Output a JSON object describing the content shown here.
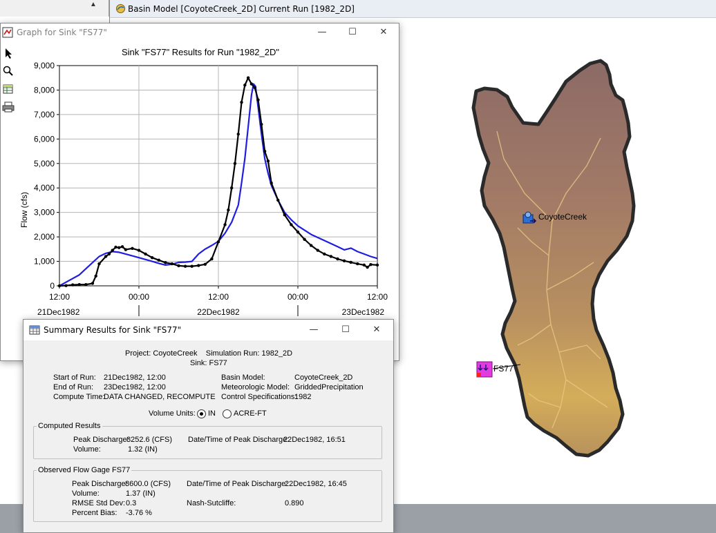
{
  "basin_window": {
    "title": "Basin Model [CoyoteCreek_2D] Current Run [1982_2D]",
    "elements": [
      {
        "name": "CoyoteCreek"
      },
      {
        "name": "FS77"
      }
    ]
  },
  "graph_window": {
    "title": "Graph for Sink \"FS77\"",
    "controls": {
      "minimize": "—",
      "maximize": "☐",
      "close": "✕"
    },
    "tools": [
      "pointer-icon",
      "zoom-icon",
      "table-icon",
      "print-icon"
    ]
  },
  "chart_data": {
    "type": "line",
    "title": "Sink \"FS77\" Results for Run \"1982_2D\"",
    "ylabel": "Flow (cfs)",
    "xlabel": "",
    "ylim": [
      0,
      9000
    ],
    "yticks": [
      "0",
      "1,000",
      "2,000",
      "3,000",
      "4,000",
      "5,000",
      "6,000",
      "7,000",
      "8,000",
      "9,000"
    ],
    "yticks_values": [
      0,
      1000,
      2000,
      3000,
      4000,
      5000,
      6000,
      7000,
      8000,
      9000
    ],
    "xlim": [
      0,
      48
    ],
    "xticks": [
      "12:00",
      "00:00",
      "12:00",
      "00:00",
      "12:00"
    ],
    "xticks_values": [
      0,
      12,
      24,
      36,
      48
    ],
    "date_labels": [
      "21Dec1982",
      "22Dec1982",
      "23Dec1982"
    ],
    "grid": true,
    "series": [
      {
        "color": "#1e1ee0",
        "marker": false,
        "points": [
          [
            0,
            0
          ],
          [
            1,
            150
          ],
          [
            3,
            450
          ],
          [
            5,
            950
          ],
          [
            6,
            1200
          ],
          [
            7,
            1330
          ],
          [
            8,
            1400
          ],
          [
            9,
            1370
          ],
          [
            10,
            1300
          ],
          [
            12,
            1150
          ],
          [
            14,
            1000
          ],
          [
            15,
            920
          ],
          [
            16,
            850
          ],
          [
            17,
            880
          ],
          [
            18,
            960
          ],
          [
            19,
            970
          ],
          [
            20,
            1000
          ],
          [
            21,
            1300
          ],
          [
            22,
            1500
          ],
          [
            23,
            1650
          ],
          [
            24,
            1820
          ],
          [
            25,
            2150
          ],
          [
            26,
            2600
          ],
          [
            27,
            3300
          ],
          [
            27.5,
            4200
          ],
          [
            28,
            5200
          ],
          [
            28.5,
            6500
          ],
          [
            29,
            7800
          ],
          [
            29.3,
            8250
          ],
          [
            29.6,
            8150
          ],
          [
            30,
            7300
          ],
          [
            30.5,
            6200
          ],
          [
            31,
            5200
          ],
          [
            31.5,
            4600
          ],
          [
            32,
            4100
          ],
          [
            33,
            3500
          ],
          [
            34,
            3000
          ],
          [
            35,
            2700
          ],
          [
            36,
            2450
          ],
          [
            38,
            2100
          ],
          [
            40,
            1850
          ],
          [
            42,
            1600
          ],
          [
            43,
            1470
          ],
          [
            44,
            1540
          ],
          [
            45,
            1400
          ],
          [
            46,
            1300
          ],
          [
            47,
            1200
          ],
          [
            48,
            1120
          ]
        ]
      },
      {
        "color": "#000000",
        "marker": true,
        "points": [
          [
            0,
            0
          ],
          [
            1,
            10
          ],
          [
            2,
            40
          ],
          [
            3,
            50
          ],
          [
            4,
            50
          ],
          [
            5,
            100
          ],
          [
            5.5,
            400
          ],
          [
            6,
            900
          ],
          [
            7,
            1200
          ],
          [
            7.5,
            1300
          ],
          [
            8,
            1450
          ],
          [
            8.5,
            1580
          ],
          [
            9,
            1560
          ],
          [
            9.5,
            1600
          ],
          [
            10,
            1480
          ],
          [
            11,
            1530
          ],
          [
            12,
            1450
          ],
          [
            13,
            1300
          ],
          [
            14,
            1150
          ],
          [
            15,
            1050
          ],
          [
            16,
            950
          ],
          [
            17,
            900
          ],
          [
            18,
            820
          ],
          [
            19,
            800
          ],
          [
            20,
            800
          ],
          [
            21,
            830
          ],
          [
            22,
            880
          ],
          [
            23,
            1100
          ],
          [
            24,
            1800
          ],
          [
            25,
            2500
          ],
          [
            25.5,
            3100
          ],
          [
            26,
            4000
          ],
          [
            26.5,
            5000
          ],
          [
            27,
            6200
          ],
          [
            27.5,
            7500
          ],
          [
            28,
            8200
          ],
          [
            28.5,
            8500
          ],
          [
            29,
            8250
          ],
          [
            29.5,
            8100
          ],
          [
            30,
            7600
          ],
          [
            30.5,
            6600
          ],
          [
            31,
            5500
          ],
          [
            31.5,
            5100
          ],
          [
            32,
            4200
          ],
          [
            33,
            3500
          ],
          [
            34,
            2900
          ],
          [
            35,
            2500
          ],
          [
            36,
            2200
          ],
          [
            37,
            1900
          ],
          [
            38,
            1650
          ],
          [
            39,
            1450
          ],
          [
            40,
            1300
          ],
          [
            41,
            1200
          ],
          [
            42,
            1100
          ],
          [
            43,
            1020
          ],
          [
            44,
            960
          ],
          [
            45,
            900
          ],
          [
            46,
            850
          ],
          [
            46.5,
            760
          ],
          [
            47,
            870
          ],
          [
            48,
            850
          ]
        ]
      }
    ]
  },
  "summary_window": {
    "title": "Summary Results for Sink \"FS77\"",
    "controls": {
      "minimize": "—",
      "maximize": "☐",
      "close": "✕"
    },
    "project_line": "Project: CoyoteCreek    Simulation Run: 1982_2D",
    "sink_line": "Sink: FS77",
    "info": {
      "start_label": "Start of Run:",
      "start_value": "21Dec1982, 12:00",
      "end_label": "End of Run:",
      "end_value": "23Dec1982, 12:00",
      "compute_label": "Compute Time:",
      "compute_value": "DATA CHANGED, RECOMPUTE",
      "basin_label": "Basin Model:",
      "basin_value": "CoyoteCreek_2D",
      "met_label": "Meteorologic Model:",
      "met_value": "GriddedPrecipitation",
      "control_label": "Control Specifications:",
      "control_value": "1982"
    },
    "volume_units": {
      "label": "Volume Units:",
      "options": [
        "IN",
        "ACRE-FT"
      ],
      "selected": "IN"
    },
    "computed": {
      "group_title": "Computed Results",
      "peak_label": "Peak Discharge:",
      "peak_value": "8252.6 (CFS)",
      "date_label": "Date/Time of Peak Discharge:",
      "date_value": "22Dec1982, 16:51",
      "volume_label": "Volume:",
      "volume_value": "1.32 (IN)"
    },
    "observed": {
      "group_title": "Observed Flow Gage FS77",
      "peak_label": "Peak Discharge:",
      "peak_value": "8600.0 (CFS)",
      "date_label": "Date/Time of Peak Discharge:",
      "date_value": "22Dec1982, 16:45",
      "volume_label": "Volume:",
      "volume_value": "1.37 (IN)",
      "rmse_label": "RMSE Std Dev:",
      "rmse_value": "0.3",
      "nash_label": "Nash-Sutcliffe:",
      "nash_value": "0.890",
      "bias_label": "Percent Bias:",
      "bias_value": "-3.76 %"
    }
  }
}
